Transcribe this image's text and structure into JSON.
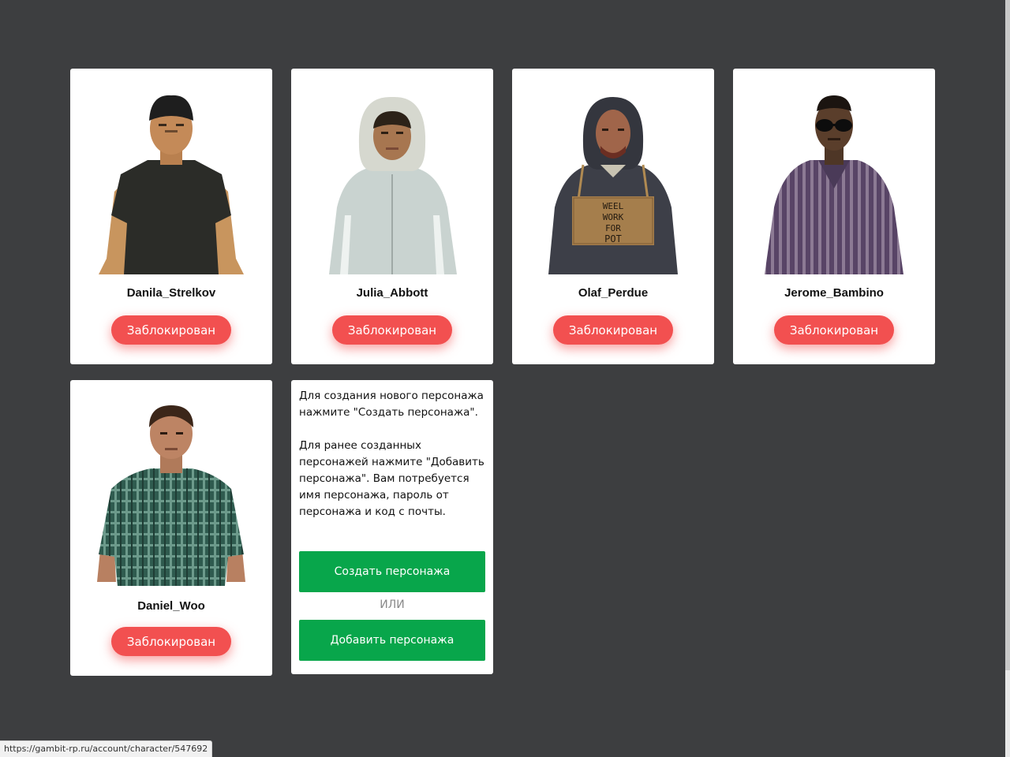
{
  "characters": [
    {
      "name": "Danila_Strelkov",
      "status": "Заблокирован",
      "avatar_icon": "man-black-cap-tank-top"
    },
    {
      "name": "Julia_Abbott",
      "status": "Заблокирован",
      "avatar_icon": "woman-white-hood-jacket"
    },
    {
      "name": "Olaf_Perdue",
      "status": "Заблокирован",
      "avatar_icon": "man-hood-with-sign"
    },
    {
      "name": "Jerome_Bambino",
      "status": "Заблокирован",
      "avatar_icon": "man-sunglasses-striped-shirt"
    },
    {
      "name": "Daniel_Woo",
      "status": "Заблокирован",
      "avatar_icon": "man-plaid-shirt"
    }
  ],
  "avatar_sign_text": [
    "WEEL",
    "WORK",
    "FOR",
    "POT"
  ],
  "info": {
    "text_1": "Для создания нового персонажа\nнажмите \"Создать персонажа\".",
    "text_2": "Для ранее созданных\nперсонажей нажмите \"Добавить\nперсонажа\". Вам потребуется\nимя персонажа, пароль от\nперсонажа и код с почты.",
    "create_label": "Создать персонажа",
    "or_label": "ИЛИ",
    "add_label": "Добавить персонажа"
  },
  "status_bar": {
    "url": "https://gambit-rp.ru/account/character/547692"
  },
  "colors": {
    "background": "#3d3e40",
    "card": "#ffffff",
    "blocked": "#f25050",
    "green": "#08a64b"
  }
}
